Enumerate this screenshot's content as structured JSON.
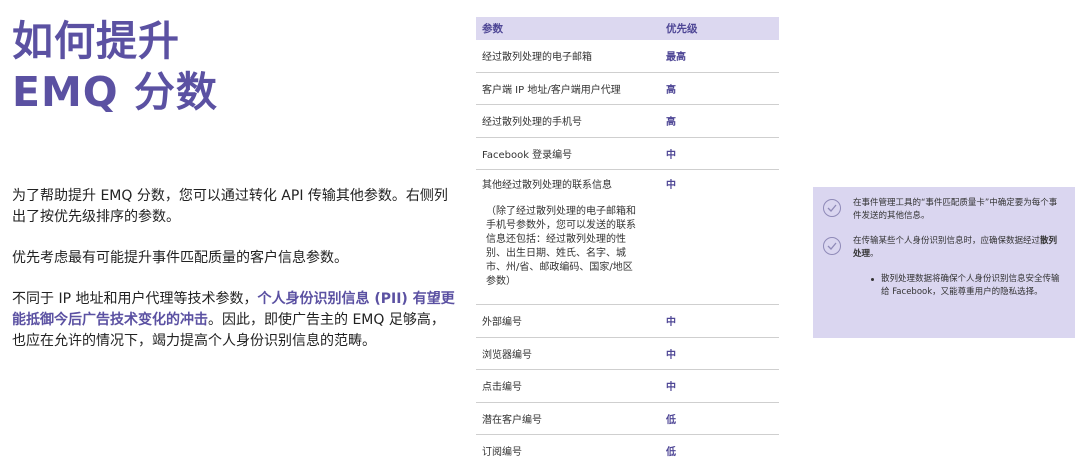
{
  "title": {
    "line1": "如何提升",
    "line2": "EMQ 分数"
  },
  "intro": {
    "p1": "为了帮助提升 EMQ 分数，您可以通过转化 API 传输其他参数。右侧列出了按优先级排序的参数。",
    "p2": "优先考虑最有可能提升事件匹配质量的客户信息参数。",
    "p3_before": "不同于 IP 地址和用户代理等技术参数，",
    "p3_highlight": "个人身份识别信息 (PII) 有望更能抵御今后广告技术变化的冲击",
    "p3_after": "。因此，即使广告主的 EMQ 足够高，也应在允许的情况下，竭力提高个人身份识别信息的范畴。"
  },
  "table": {
    "headers": {
      "param": "参数",
      "priority": "优先级"
    },
    "rows": [
      {
        "param": "经过散列处理的电子邮箱",
        "priority": "最高"
      },
      {
        "param": "客户端 IP 地址/客户端用户代理",
        "priority": "高"
      },
      {
        "param": "经过散列处理的手机号",
        "priority": "高"
      },
      {
        "param": "Facebook 登录编号",
        "priority": "中"
      },
      {
        "param": "其他经过散列处理的联系信息",
        "priority": "中",
        "note": "（除了经过散列处理的电子邮箱和手机号参数外，您可以发送的联系信息还包括：经过散列处理的性别、出生日期、姓氏、名字、城市、州/省、邮政编码、国家/地区参数）"
      },
      {
        "param": "外部编号",
        "priority": "中"
      },
      {
        "param": "浏览器编号",
        "priority": "中"
      },
      {
        "param": "点击编号",
        "priority": "中"
      },
      {
        "param": "潜在客户编号",
        "priority": "低"
      },
      {
        "param": "订阅编号",
        "priority": "低"
      }
    ]
  },
  "side_box": {
    "item1": "在事件管理工具的“事件匹配质量卡”中确定要为每个事件发送的其他信息。",
    "item2_normal": "在传输某些个人身份识别信息时，应确保数据经过",
    "item2_bold": "散列处理",
    "item2_end": "。",
    "bullet": "散列处理数据将确保个人身份识别信息安全传输给 Facebook，又能尊重用户的隐私选择。"
  }
}
